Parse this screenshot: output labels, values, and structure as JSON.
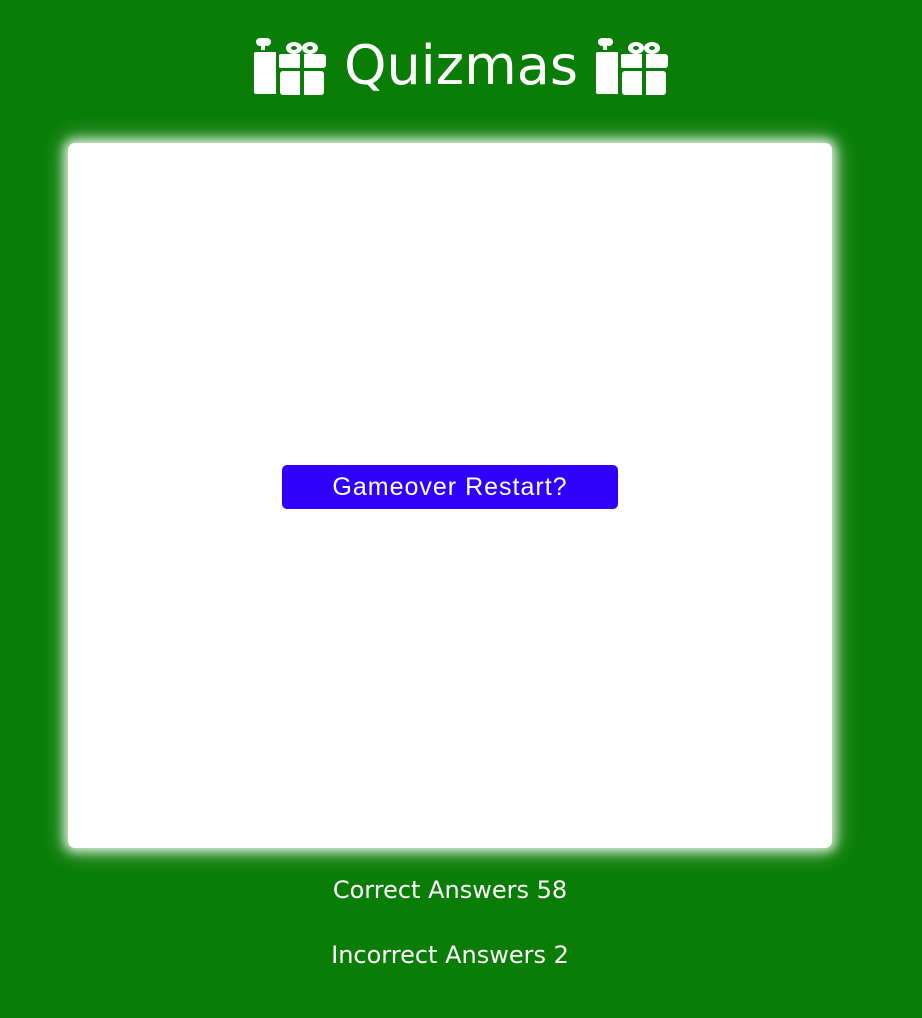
{
  "header": {
    "title": "Quizmas",
    "left_icon": "gifts-icon",
    "right_icon": "gifts-icon"
  },
  "game": {
    "restart_label": "Gameover Restart?"
  },
  "scores": {
    "correct_label": "Correct Answers",
    "correct_count": "58",
    "incorrect_label": "Incorrect Answers",
    "incorrect_count": "2"
  },
  "colors": {
    "background": "#097d06",
    "card": "#ffffff",
    "button": "#3000ff",
    "text": "#ffffff"
  }
}
